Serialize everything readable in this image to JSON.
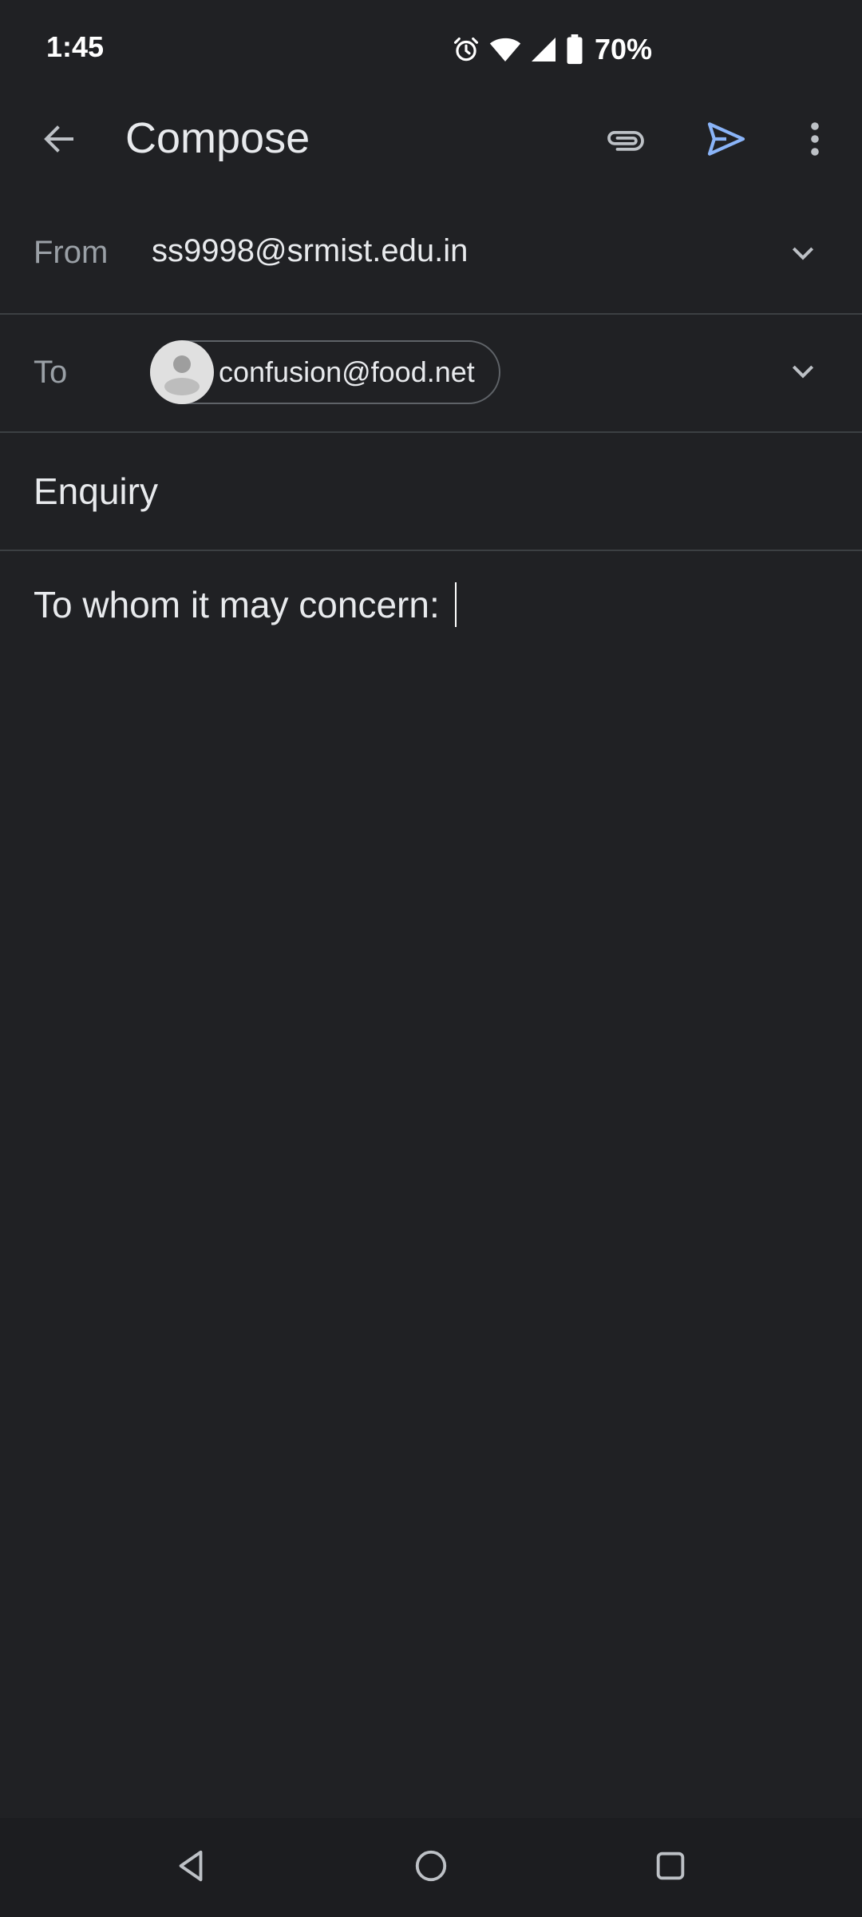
{
  "status_bar": {
    "time": "1:45",
    "battery_percent": "70%",
    "icons": [
      "alarm-icon",
      "wifi-icon",
      "signal-icon",
      "battery-icon"
    ]
  },
  "app_bar": {
    "title": "Compose",
    "icons": [
      "back-arrow-icon",
      "paperclip-icon",
      "send-icon",
      "more-vert-icon"
    ],
    "send_color": "#8ab4f8"
  },
  "compose": {
    "from_label": "From",
    "from_value": "ss9998@srmist.edu.in",
    "to_label": "To",
    "to_recipients": [
      "confusion@food.net"
    ],
    "subject": "Enquiry",
    "body": "To whom it may concern: "
  },
  "nav_bar": {
    "icons": [
      "nav-back-icon",
      "nav-home-icon",
      "nav-recents-icon"
    ]
  },
  "colors": {
    "background": "#202124",
    "divider": "#3c4043",
    "text_primary": "#e8eaed",
    "text_secondary": "#9aa0a6",
    "accent": "#8ab4f8"
  }
}
